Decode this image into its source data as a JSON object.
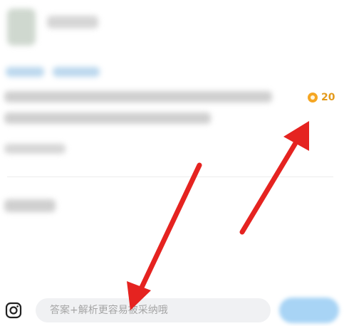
{
  "question": {
    "reward": {
      "icon": "coin-icon",
      "value": "20",
      "color": "#e39a1c"
    }
  },
  "answer_bar": {
    "camera_icon": "camera-icon",
    "input_placeholder": "答案+解析更容易被采纳哦",
    "input_value": ""
  },
  "annotations": {
    "arrow_color": "#e52320"
  }
}
